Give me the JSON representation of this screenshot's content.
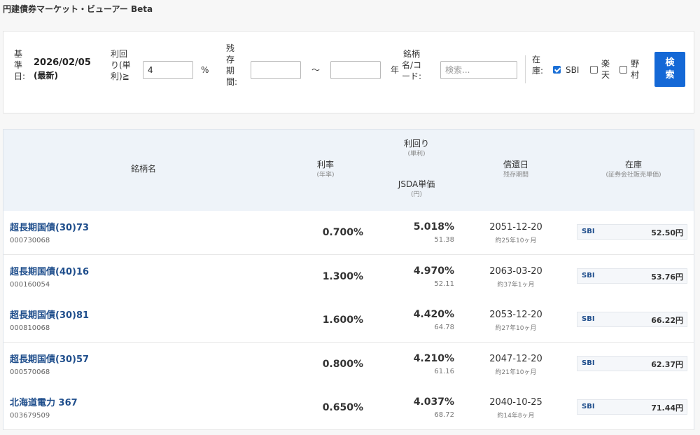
{
  "app": {
    "title": "円建債券マーケット・ビューアー Beta"
  },
  "filters": {
    "base_date_label": "基\n準\n日:",
    "base_date_value": "2026/02/05",
    "base_date_note": "(最新)",
    "yield_label": "利回\nり(単\n利)≧",
    "yield_value": "4",
    "yield_unit": "%",
    "term_label": "残\n存\n期\n間:",
    "term_from": "",
    "term_to": "",
    "term_sep": "〜",
    "term_unit": "年",
    "name_label": "銘柄\n名/コ\nード:",
    "name_placeholder": "検索...",
    "stock_label": "在\n庫:",
    "brokers": [
      {
        "label": "SBI",
        "checked": true
      },
      {
        "label": "楽\n天",
        "checked": false
      },
      {
        "label": "野\n村",
        "checked": false
      }
    ],
    "search_button": "検\n索"
  },
  "table": {
    "headers": {
      "name": "銘柄名",
      "coupon": "利率",
      "coupon_sub": "(年率)",
      "yield": "利回り",
      "yield_sub": "(単利)",
      "price": "JSDA単価",
      "price_sub": "(円)",
      "maturity": "償還日",
      "maturity_sub": "残存期間",
      "stock": "在庫",
      "stock_sub": "(証券会社販売単価)"
    },
    "rows": [
      {
        "name": "超長期国債(30)73",
        "code": "000730068",
        "coupon": "0.700%",
        "yield": "5.018%",
        "price": "51.38",
        "maturity": "2051-12-20",
        "remaining": "約25年10ヶ月",
        "broker": "SBI",
        "broker_price": "52.50円"
      },
      {
        "name": "超長期国債(40)16",
        "code": "000160054",
        "coupon": "1.300%",
        "yield": "4.970%",
        "price": "52.11",
        "maturity": "2063-03-20",
        "remaining": "約37年1ヶ月",
        "broker": "SBI",
        "broker_price": "53.76円"
      },
      {
        "name": "超長期国債(30)81",
        "code": "000810068",
        "coupon": "1.600%",
        "yield": "4.420%",
        "price": "64.78",
        "maturity": "2053-12-20",
        "remaining": "約27年10ヶ月",
        "broker": "SBI",
        "broker_price": "66.22円"
      },
      {
        "name": "超長期国債(30)57",
        "code": "000570068",
        "coupon": "0.800%",
        "yield": "4.210%",
        "price": "61.16",
        "maturity": "2047-12-20",
        "remaining": "約21年10ヶ月",
        "broker": "SBI",
        "broker_price": "62.37円"
      },
      {
        "name": "北海道電力 367",
        "code": "003679509",
        "coupon": "0.650%",
        "yield": "4.037%",
        "price": "68.72",
        "maturity": "2040-10-25",
        "remaining": "約14年8ヶ月",
        "broker": "SBI",
        "broker_price": "71.44円"
      }
    ]
  }
}
